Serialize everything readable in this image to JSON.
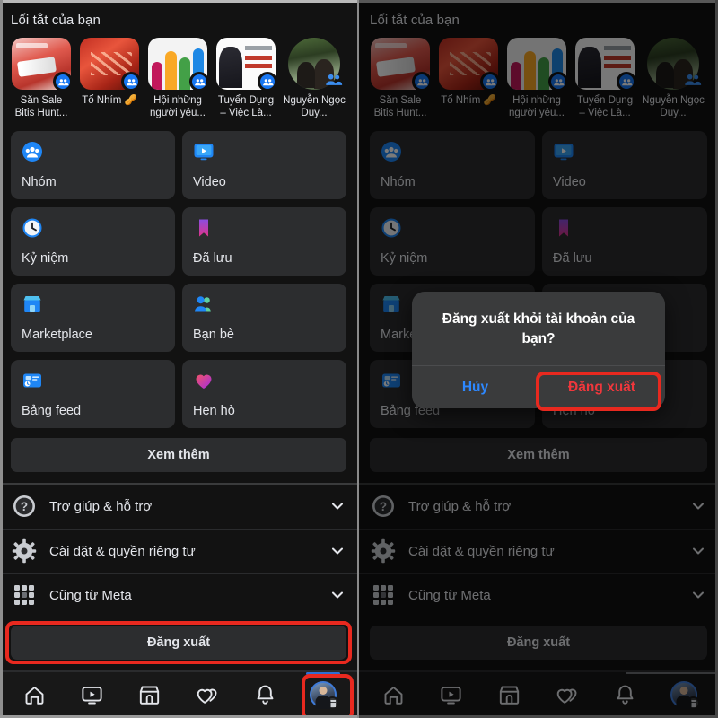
{
  "app": {
    "screen_title": "Lối tắt của bạn",
    "accent_blue": "#1877f2",
    "highlight_red": "#e8291f",
    "background": "#121212",
    "tile_background": "#2c2d2f",
    "text_primary": "#e4e6eb"
  },
  "shortcuts": {
    "title": "Lối tắt của bạn",
    "items": [
      {
        "label": "Săn Sale Bitis Hunt...",
        "badge": "group-badge-icon",
        "shape": "rounded"
      },
      {
        "label": "Tổ Nhím 🥜",
        "badge": "group-badge-icon",
        "shape": "rounded"
      },
      {
        "label": "Hội những người yêu...",
        "badge": "group-badge-icon",
        "shape": "rounded"
      },
      {
        "label": "Tuyển Dụng – Việc Là...",
        "badge": "group-badge-icon",
        "shape": "rounded"
      },
      {
        "label": "Nguyễn Ngọc Duy...",
        "badge": "group-badge-icon",
        "shape": "circle"
      }
    ]
  },
  "tiles": [
    {
      "label": "Nhóm",
      "icon": "groups-icon"
    },
    {
      "label": "Video",
      "icon": "video-icon"
    },
    {
      "label": "Kỷ niệm",
      "icon": "memories-clock-icon"
    },
    {
      "label": "Đã lưu",
      "icon": "saved-bookmark-icon"
    },
    {
      "label": "Marketplace",
      "icon": "marketplace-storefront-icon"
    },
    {
      "label": "Bạn bè",
      "icon": "friends-icon"
    },
    {
      "label": "Bảng feed",
      "icon": "feeds-icon"
    },
    {
      "label": "Hẹn hò",
      "icon": "dating-heart-icon"
    }
  ],
  "see_more_label": "Xem thêm",
  "accordion": [
    {
      "label": "Trợ giúp & hỗ trợ",
      "icon": "help-question-icon",
      "chevron": "chevron-down-icon"
    },
    {
      "label": "Cài đặt & quyền riêng tư",
      "icon": "settings-gear-icon",
      "chevron": "chevron-down-icon"
    },
    {
      "label": "Cũng từ Meta",
      "icon": "meta-apps-grid-icon",
      "chevron": "chevron-down-icon"
    }
  ],
  "logout_label": "Đăng xuất",
  "navbar": [
    {
      "name": "home",
      "icon": "home-icon",
      "active": false
    },
    {
      "name": "video",
      "icon": "video-monitor-icon",
      "active": false
    },
    {
      "name": "marketplace",
      "icon": "marketplace-storefront-icon",
      "active": false
    },
    {
      "name": "dating",
      "icon": "dating-hearts-icon",
      "active": false
    },
    {
      "name": "notifications",
      "icon": "bell-icon",
      "active": false
    },
    {
      "name": "profile",
      "icon": "profile-avatar-icon",
      "active": true
    }
  ],
  "dialog": {
    "title": "Đăng xuất khỏi tài khoản của bạn?",
    "cancel_label": "Hủy",
    "confirm_label": "Đăng xuất",
    "cancel_color": "#2d88ff",
    "confirm_color": "#f0373c",
    "background": "#3a3b3c"
  }
}
